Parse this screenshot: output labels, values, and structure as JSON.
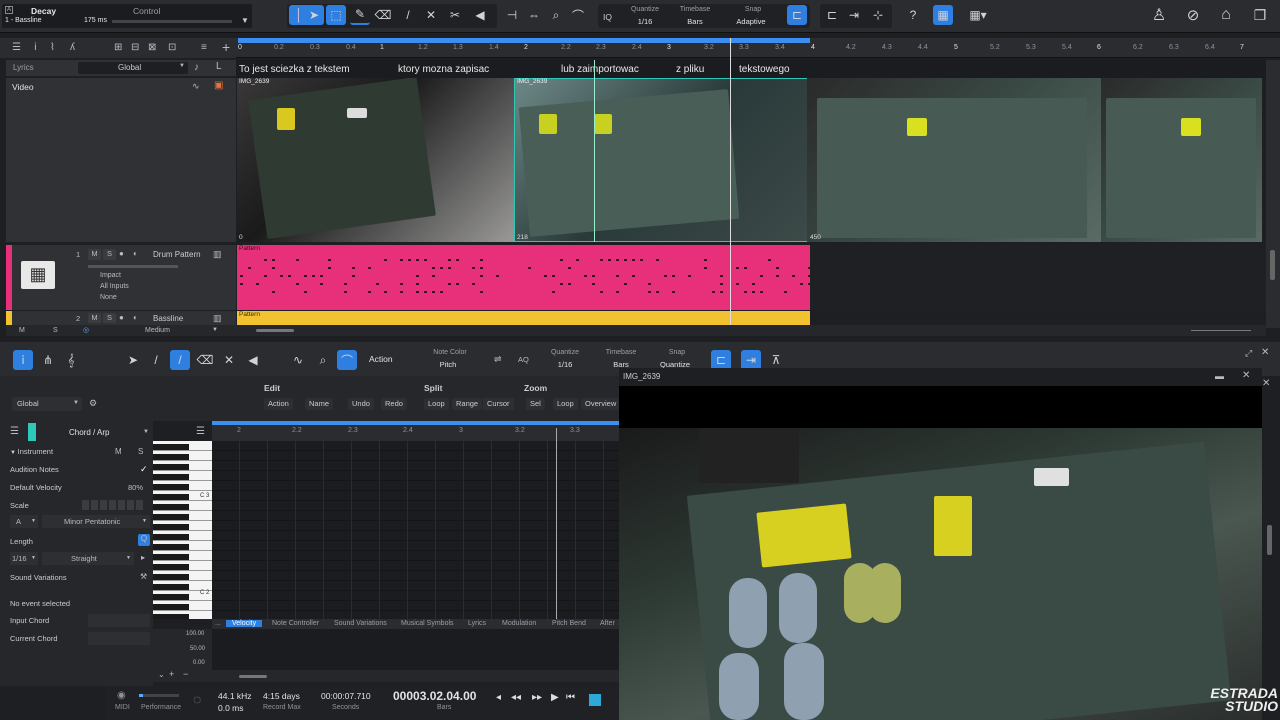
{
  "top_left": {
    "preset": "Decay",
    "track": "1 - Bassline",
    "param_label": "Control",
    "time": "175 ms"
  },
  "toolbar": {
    "quantize_label": "Quantize",
    "quantize_value": "1/16",
    "timebase_label": "Timebase",
    "timebase_value": "Bars",
    "snap_label": "Snap",
    "snap_value": "Adaptive",
    "iq": "IQ",
    "help": "?"
  },
  "ruler": [
    "0",
    "0.2",
    "0.3",
    "0.4",
    "1",
    "1.2",
    "1.3",
    "1.4",
    "2",
    "2.2",
    "2.3",
    "2.4",
    "3",
    "3.2",
    "3.3",
    "3.4",
    "4",
    "4.2",
    "4.3",
    "4.4",
    "5",
    "5.2",
    "5.3",
    "5.4",
    "6",
    "6.2",
    "6.3",
    "6.4",
    "7"
  ],
  "lyrics_track": {
    "label": "Lyrics",
    "scope": "Global",
    "words": [
      "To jest sciezka z tekstem",
      "ktory mozna zapisac",
      "lub zaimportowac",
      "z pliku",
      "tekstowego"
    ]
  },
  "video_track": {
    "label": "Video",
    "clip_name": "IMG_2639",
    "frame_start": "0",
    "frame_mid": "218",
    "frame_end": "450"
  },
  "tracks": [
    {
      "num": "1",
      "name": "Drum Pattern",
      "m": "M",
      "s": "S",
      "impact": "Impact",
      "inputs": "All Inputs",
      "out": "None",
      "clip": "Pattern"
    },
    {
      "num": "2",
      "name": "Bassline",
      "m": "M",
      "s": "S",
      "clip": "Pattern"
    }
  ],
  "footer_tracks": {
    "m": "M",
    "s": "S",
    "size": "Medium"
  },
  "editor_toolbar": {
    "action": "Action",
    "note_color_label": "Note Color",
    "note_color_value": "Pitch",
    "aq": "AQ",
    "quantize_label": "Quantize",
    "quantize_value": "1/16",
    "timebase_label": "Timebase",
    "timebase_value": "Bars",
    "snap_label": "Snap",
    "snap_value": "Quantize"
  },
  "edit_groups": {
    "edit": "Edit",
    "split": "Split",
    "zoom": "Zoom",
    "edit_btns": [
      "Action",
      "Name",
      "Undo",
      "Redo"
    ],
    "split_btns": [
      "Loop",
      "Range",
      "Cursor"
    ],
    "zoom_btns": [
      "Sel",
      "Loop",
      "Overview"
    ],
    "global": "Global"
  },
  "inspector": {
    "chord_arp": "Chord / Arp",
    "instrument": "Instrument",
    "m": "M",
    "s": "S",
    "audition_notes": "Audition Notes",
    "default_velocity": "Default Velocity",
    "default_velocity_value": "80%",
    "scale": "Scale",
    "scale_root": "A",
    "scale_type": "Minor Pentatonic",
    "length": "Length",
    "length_value": "1/16",
    "length_mode": "Straight",
    "sound_variations": "Sound Variations",
    "no_event": "No event selected",
    "input_chord": "Input Chord",
    "current_chord": "Current Chord"
  },
  "piano_ruler": [
    "2",
    "2.2",
    "2.3",
    "2.4",
    "3",
    "3.2",
    "3.3"
  ],
  "piano_keys": {
    "c3": "C 3",
    "c2": "C 2"
  },
  "controller_tabs": [
    "...",
    "Velocity",
    "Note Controller",
    "Sound Variations",
    "Musical Symbols",
    "Lyrics",
    "Modulation",
    "Pitch Bend",
    "After"
  ],
  "velocity_scale": [
    "100.00",
    "50.00",
    "0.00"
  ],
  "transport": {
    "midi": "MIDI",
    "performance": "Performance",
    "sample_rate": "44.1 kHz",
    "latency": "0.0 ms",
    "record_max": "4:15 days",
    "record_max_label": "Record Max",
    "seconds": "00:00:07.710",
    "seconds_label": "Seconds",
    "position": "00003.02.04.00",
    "position_label": "Bars"
  },
  "video_window": {
    "title": "IMG_2639"
  },
  "watermark": {
    "line1": "ESTRADA",
    "line2": "STUDIO"
  },
  "colors": {
    "accent": "#2f7fe0",
    "pattern_pink": "#e8307a",
    "pattern_yellow": "#f2c230",
    "teal": "#2ec7b8"
  }
}
